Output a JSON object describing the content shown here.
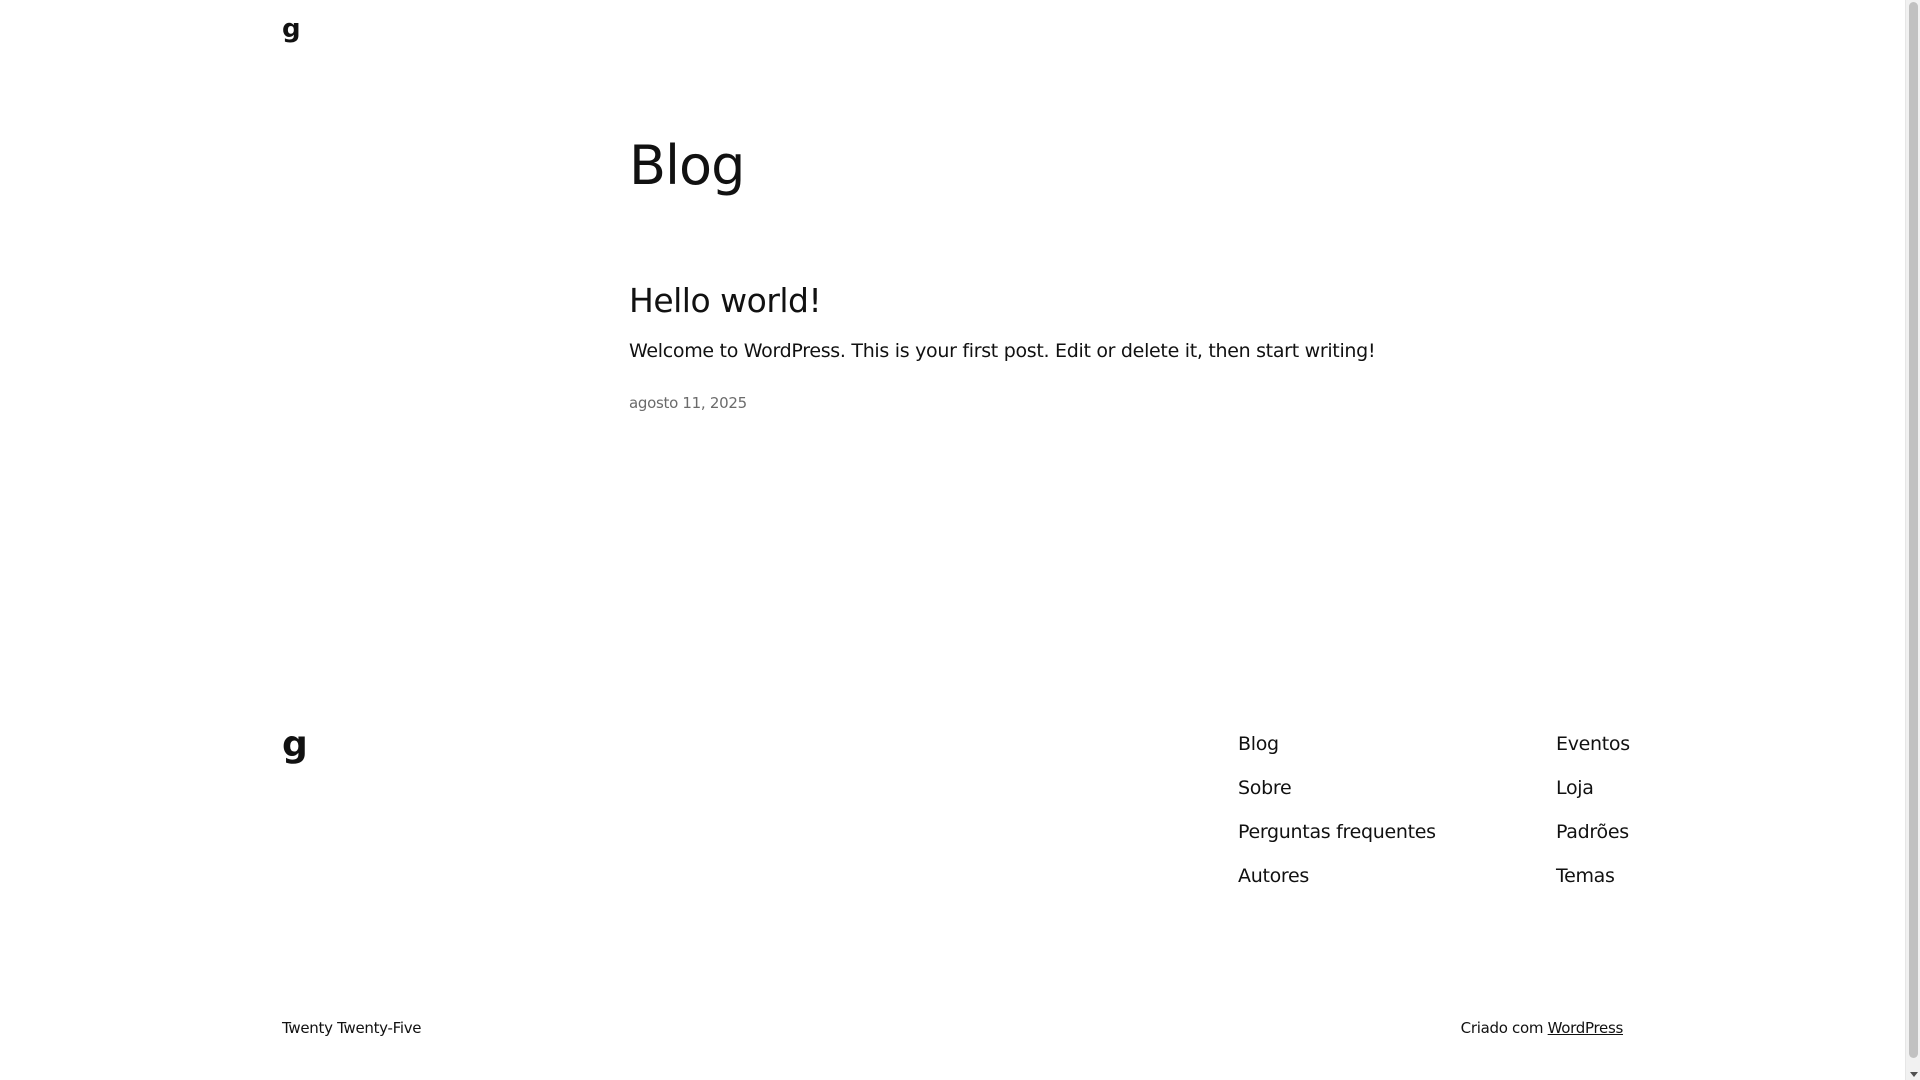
{
  "header": {
    "site_logo": "g"
  },
  "main": {
    "page_title": "Blog",
    "posts": [
      {
        "title": "Hello world!",
        "excerpt": "Welcome to WordPress. This is your first post. Edit or delete it, then start writing!",
        "date": "agosto 11, 2025"
      }
    ]
  },
  "footer": {
    "site_logo": "g",
    "nav_column_1": [
      "Blog",
      "Sobre",
      "Perguntas frequentes",
      "Autores"
    ],
    "nav_column_2": [
      "Eventos",
      "Loja",
      "Padrões",
      "Temas"
    ],
    "theme_name": "Twenty Twenty-Five",
    "credit_prefix": "Criado com ",
    "credit_link": "WordPress"
  }
}
